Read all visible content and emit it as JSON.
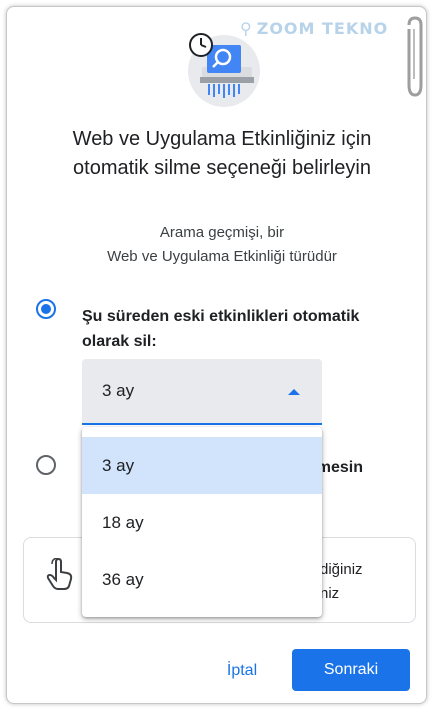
{
  "watermark": {
    "text": "ZOOM TEKNO"
  },
  "dialog": {
    "title": "Web ve Uygulama Etkinliğiniz için otomatik silme seçeneği belirleyin",
    "subtitle_line1": "Arama geçmişi, bir",
    "subtitle_line2": "Web ve Uygulama Etkinliği türüdür"
  },
  "options": {
    "auto_delete_label": "Şu süreden eski etkinlikleri otomatik olarak sil:",
    "second_option_partial": "nmesin"
  },
  "select": {
    "value": "3 ay",
    "options": [
      "3 ay",
      "18 ay",
      "36 ay"
    ],
    "selected_index": 0
  },
  "card": {
    "line1": "diğiniz",
    "line2": "niz"
  },
  "buttons": {
    "cancel": "İptal",
    "next": "Sonraki"
  },
  "colors": {
    "accent": "#1a73e8",
    "selected_bg": "#d2e3fc",
    "select_bg": "#e8eaed"
  },
  "icons": {
    "illustration": "clock-shredder-illustration",
    "card_icon": "touch-hand-icon"
  }
}
